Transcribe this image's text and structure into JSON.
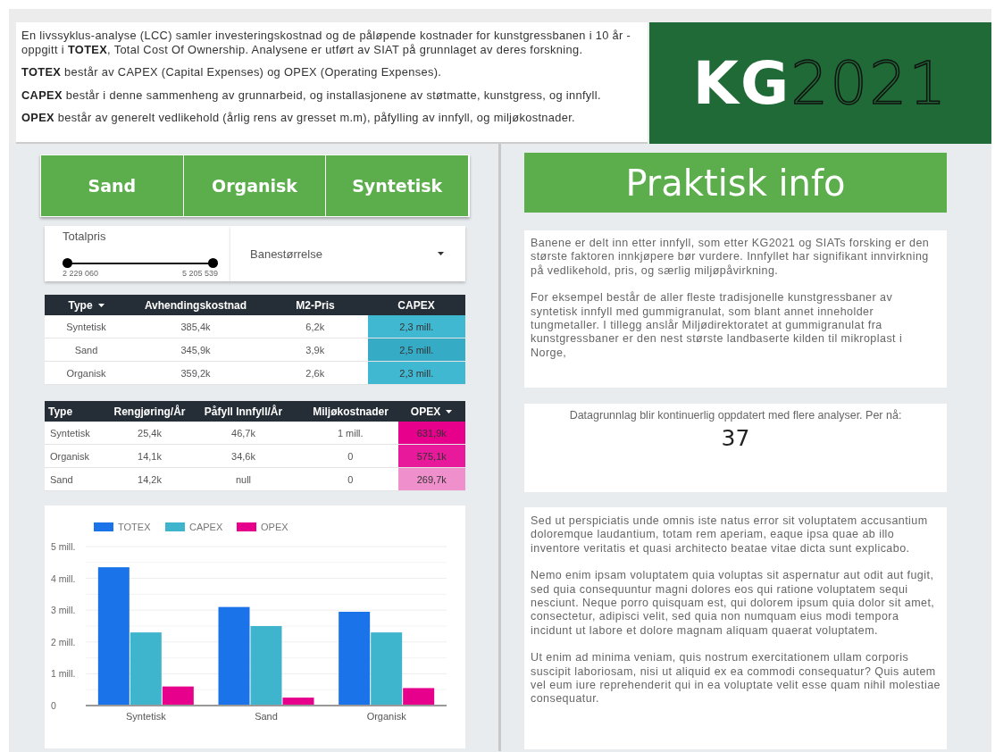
{
  "intro": {
    "paragraphs": [
      "En livssyklus-analyse (LCC) samler investeringskostnad og de påløpende kostnader for kunstgressbanen i 10 år - oppgitt i **TOTEX**, Total Cost Of Ownership. Analysene er utført av SIAT på grunnlaget av deres forskning.",
      "**TOTEX** består av CAPEX (Capital Expenses) og OPEX (Operating Expenses).",
      "**CAPEX** består i denne sammenheng av grunnarbeid, og installasjonene av støtmatte, kunstgress, og innfyll.",
      "**OPEX** består av generelt vedlikehold (årlig rens av gresset m.m), påfylling av innfyll, og miljøkostnader."
    ]
  },
  "logo": {
    "bold": "KG",
    "light": "2021"
  },
  "filter_buttons": [
    {
      "label": "Sand",
      "selected": false
    },
    {
      "label": "Organisk",
      "selected": false
    },
    {
      "label": "Syntetisk",
      "selected": false
    }
  ],
  "price_slider": {
    "label": "Totalpris",
    "min_label": "2 229 060",
    "max_label": "5 205 539",
    "thumbs": [
      {
        "level": 0
      },
      {
        "level": 1
      }
    ]
  },
  "size_dropdown": {
    "label": "Banestørrelse"
  },
  "tables": [
    {
      "columns": [
        {
          "label": "Type",
          "sorted": true
        },
        {
          "label": "Avhendingskostnad",
          "sorted": false
        },
        {
          "label": "M2-Pris",
          "sorted": false
        },
        {
          "label": "CAPEX",
          "sorted": false
        }
      ],
      "rows": [
        {
          "cells": [
            "Syntetisk",
            "385,4k",
            "6,2k",
            "2,3 mill."
          ],
          "color": "#41b8d2"
        },
        {
          "cells": [
            "Sand",
            "345,9k",
            "3,9k",
            "2,5 mill."
          ],
          "color": "#36abc6"
        },
        {
          "cells": [
            "Organisk",
            "359,2k",
            "2,6k",
            "2,3 mill."
          ],
          "color": "#41b8d2"
        }
      ]
    },
    {
      "columns": [
        {
          "label": "Type",
          "sorted": false
        },
        {
          "label": "Rengjøring/År",
          "sorted": false
        },
        {
          "label": "Påfyll Innfyll/År",
          "sorted": false
        },
        {
          "label": "Miljøkostnader",
          "sorted": false
        },
        {
          "label": "OPEX",
          "sorted": true
        }
      ],
      "rows": [
        {
          "cells": [
            "Syntetisk",
            "25,4k",
            "46,7k",
            "1 mill.",
            "631,9k"
          ],
          "color": "#e6008c"
        },
        {
          "cells": [
            "Organisk",
            "14,1k",
            "34,6k",
            "0",
            "575,1k"
          ],
          "color": "#e8199a"
        },
        {
          "cells": [
            "Sand",
            "14,2k",
            "null",
            "0",
            "269,7k"
          ],
          "color": "#ef8fcc"
        }
      ]
    }
  ],
  "chart": {
    "chart_data": {
      "type": "bar",
      "categories": [
        "Syntetisk",
        "Sand",
        "Organisk"
      ],
      "series": [
        {
          "name": "TOTEX",
          "color": "#1a73e8",
          "values": [
            4.35,
            3.1,
            2.95
          ]
        },
        {
          "name": "CAPEX",
          "color": "#3fb5cd",
          "values": [
            2.3,
            2.5,
            2.3
          ]
        },
        {
          "name": "OPEX",
          "color": "#e6008c",
          "values": [
            0.6,
            0.25,
            0.55
          ]
        }
      ],
      "ylim": [
        0,
        5
      ],
      "grid": true,
      "legend": "top",
      "yticks": [
        {
          "value": 0,
          "label": "0"
        },
        {
          "value": 1,
          "label": "1 mill."
        },
        {
          "value": 2,
          "label": "2 mill."
        },
        {
          "value": 3,
          "label": "3 mill."
        },
        {
          "value": 4,
          "label": "4 mill."
        },
        {
          "value": 5,
          "label": "5 mill."
        }
      ]
    }
  },
  "info_title": "Praktisk info",
  "info_text": [
    "Banene er delt inn etter innfyll, som etter KG2021 og SIATs forsking er den største faktoren innkjøpere bør vurdere. Innfyllet har signifikant innvirkning på vedlikehold, pris, og særlig miljøpåvirkning.",
    "For eksempel består de aller fleste tradisjonelle kunstgressbaner av syntetisk innfyll med gummigranulat, som blant annet inneholder tungmetaller. I tillegg anslår Miljødirektoratet at gummigranulat fra kunstgressbaner er den nest største landbaserte kilden til mikroplast i Norge,"
  ],
  "analysis_count": {
    "label": "Datagrunnlag blir kontinuerlig oppdatert med flere analyser. Per nå:",
    "value": "37"
  },
  "lorem_text": [
    "Sed ut perspiciatis unde omnis iste natus error sit voluptatem accusantium doloremque laudantium, totam rem aperiam, eaque ipsa quae ab illo inventore veritatis et quasi architecto beatae vitae dicta sunt explicabo.",
    "Nemo enim ipsam voluptatem quia voluptas sit aspernatur aut odit aut fugit, sed quia consequuntur magni dolores eos qui ratione voluptatem sequi nesciunt. Neque porro quisquam est, qui dolorem ipsum quia dolor sit amet, consectetur, adipisci velit, sed quia non numquam eius modi tempora incidunt ut labore et dolore magnam aliquam quaerat voluptatem.",
    "Ut enim ad minima veniam, quis nostrum exercitationem ullam corporis suscipit laboriosam, nisi ut aliquid ex ea commodi consequatur? Quis autem vel eum iure reprehenderit qui in ea voluptate velit esse quam nihil molestiae consequatur."
  ]
}
